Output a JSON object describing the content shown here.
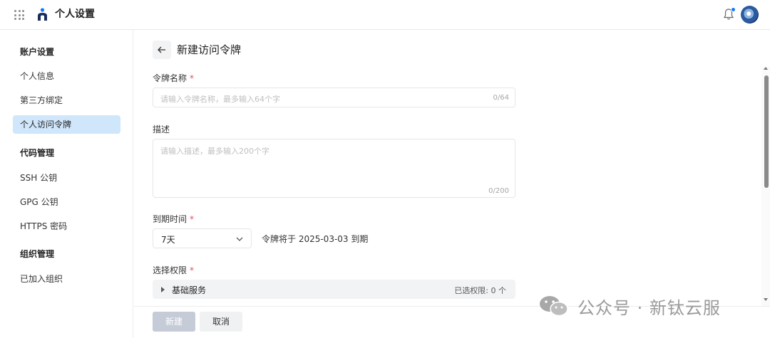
{
  "header": {
    "title": "个人设置"
  },
  "sidebar": {
    "groups": [
      {
        "label": "账户设置"
      },
      {
        "label": "代码管理"
      },
      {
        "label": "组织管理"
      }
    ],
    "items": [
      {
        "label": "个人信息"
      },
      {
        "label": "第三方绑定"
      },
      {
        "label": "个人访问令牌",
        "active": true
      },
      {
        "label": "SSH 公钥"
      },
      {
        "label": "GPG 公钥"
      },
      {
        "label": "HTTPS 密码"
      },
      {
        "label": "已加入组织"
      }
    ]
  },
  "main": {
    "title": "新建访问令牌",
    "token_name": {
      "label": "令牌名称",
      "required_mark": "*",
      "placeholder": "请输入令牌名称，最多输入64个字",
      "count": "0/64"
    },
    "description": {
      "label": "描述",
      "placeholder": "请输入描述，最多输入200个字",
      "count": "0/200"
    },
    "expiry": {
      "label": "到期时间",
      "required_mark": "*",
      "selected": "7天",
      "note": "令牌将于 2025-03-03 到期"
    },
    "permissions": {
      "label": "选择权限",
      "required_mark": "*",
      "group_name": "基础服务",
      "selected_count": "已选权限: 0 个"
    }
  },
  "footer": {
    "create_label": "新建",
    "cancel_label": "取消"
  },
  "watermark": {
    "text": "公众号 · 新钛云服"
  },
  "colors": {
    "accent": "#1677ff",
    "active_item_bg": "#cfe6fb",
    "required": "#e34d59",
    "primary_disabled": "#c5ccd8"
  }
}
